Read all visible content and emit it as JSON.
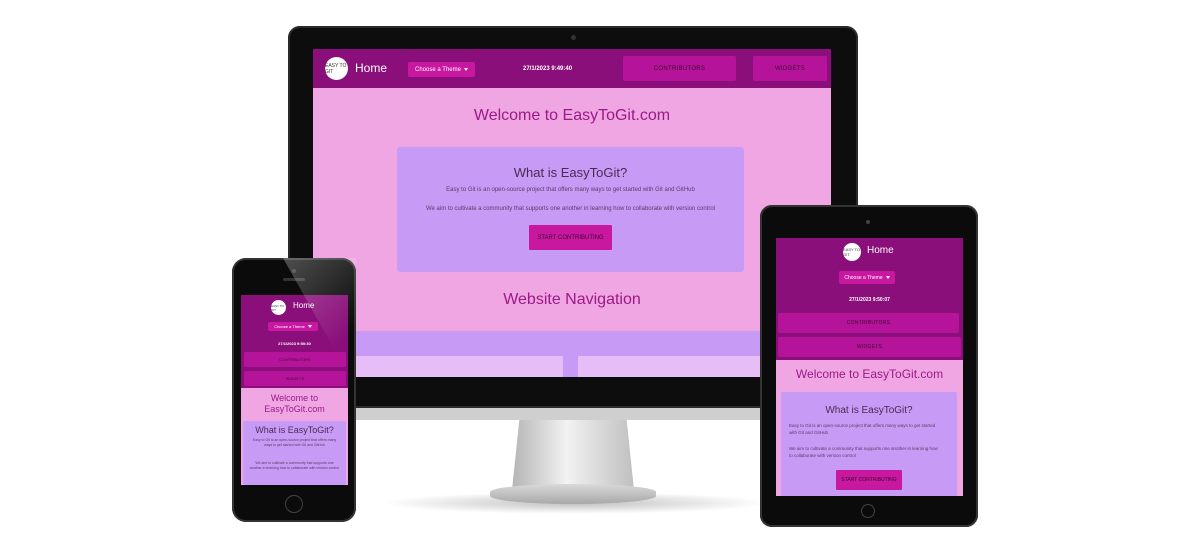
{
  "site": {
    "logo_text": "EASY TO GIT",
    "home_label": "Home",
    "theme_label": "Choose a Theme",
    "contributors_label": "CONTRIBUTORS",
    "widgets_label": "WIDGETS",
    "welcome_title": "Welcome to EasyToGit.com",
    "card_title": "What is EasyToGit?",
    "card_text_1": "Easy to Git is an open-source project that offers many ways to get started with Git and GitHub",
    "card_text_2": "We aim to cultivate a community that supports one another in learning how to collaborate with version control",
    "cta_label": "START CONTRIBUTING",
    "nav_section_title": "Website Navigation"
  },
  "devices": {
    "desktop": {
      "clock": "27/1/2023 9:49:40"
    },
    "tablet": {
      "clock": "27/1/2023 9:50:07"
    },
    "phone": {
      "clock": "27/1/2023 9:50:30"
    }
  },
  "colors": {
    "navbar": "#8a0f7a",
    "page_bg": "#f0a6e3",
    "card_bg": "#c79bf5",
    "accent": "#c8189f",
    "heading": "#9a1a86"
  }
}
